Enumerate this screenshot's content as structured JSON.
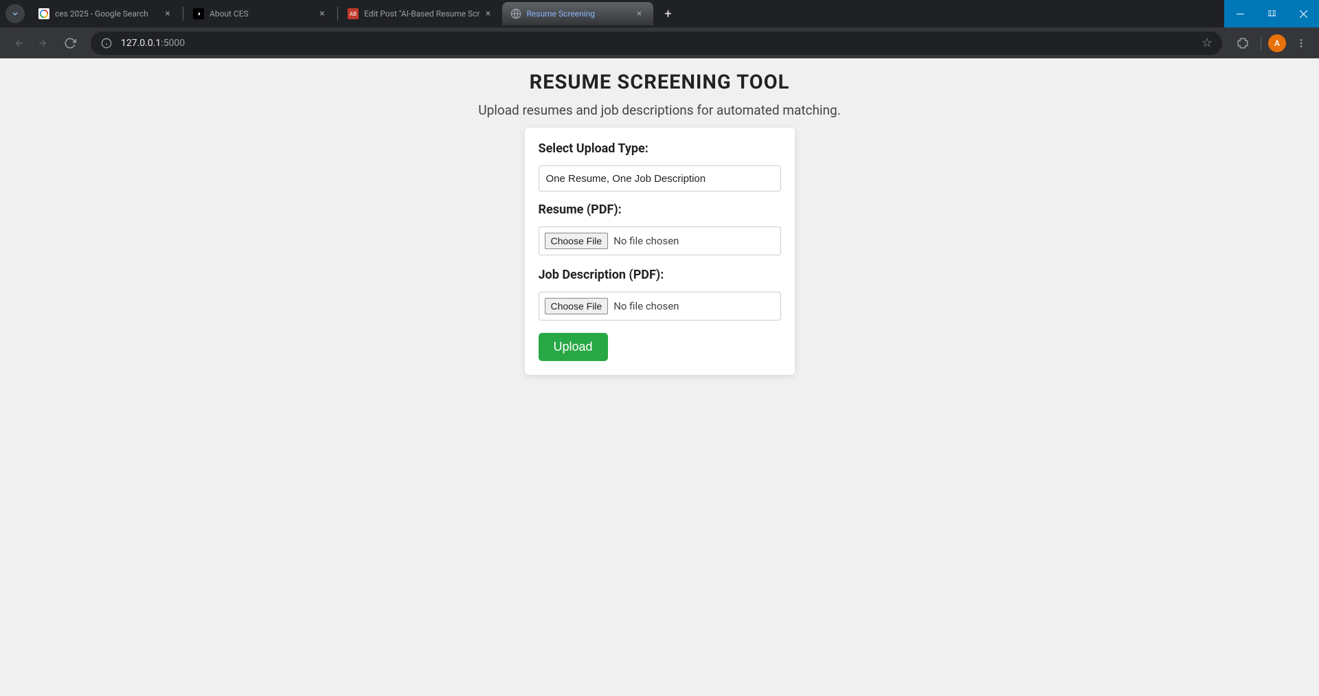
{
  "browser": {
    "tabs": [
      {
        "title": "ces 2025 - Google Search",
        "favicon": "google"
      },
      {
        "title": "About CES",
        "favicon": "ces"
      },
      {
        "title": "Edit Post \"AI-Based Resume Scr",
        "favicon": "edit"
      },
      {
        "title": "Resume Screening",
        "favicon": "globe"
      }
    ],
    "url_host": "127.0.0.1",
    "url_port": ":5000",
    "profile_initial": "A"
  },
  "page": {
    "title": "RESUME SCREENING TOOL",
    "subtitle": "Upload resumes and job descriptions for automated matching.",
    "form": {
      "upload_type_label": "Select Upload Type:",
      "upload_type_value": "One Resume, One Job Description",
      "resume_label": "Resume (PDF):",
      "resume_button": "Choose File",
      "resume_status": "No file chosen",
      "jd_label": "Job Description (PDF):",
      "jd_button": "Choose File",
      "jd_status": "No file chosen",
      "submit_label": "Upload"
    }
  }
}
